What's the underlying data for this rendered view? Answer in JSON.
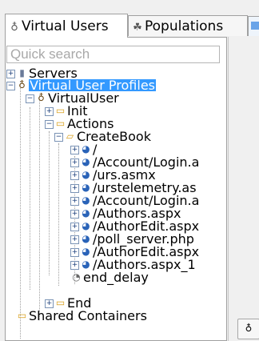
{
  "tabs": [
    {
      "label": "Virtual Users",
      "icon": "user-icon"
    },
    {
      "label": "Populations",
      "icon": "users-icon"
    }
  ],
  "search": {
    "placeholder": "Quick search"
  },
  "tree": {
    "servers": "Servers",
    "vup": "Virtual User Profiles",
    "virtual_user": "VirtualUser",
    "init": "Init",
    "actions": "Actions",
    "createbook": "CreateBook",
    "requests": [
      "/",
      "/Account/Login.a",
      "/urs.asmx",
      "/urstelemetry.as",
      "/Account/Login.a",
      "/Authors.aspx",
      "/AuthorEdit.aspx",
      "/poll_server.php",
      "/AuthorEdit.aspx",
      "/Authors.aspx_1"
    ],
    "end_delay": "end_delay",
    "end": "End",
    "shared": "Shared Containers"
  }
}
